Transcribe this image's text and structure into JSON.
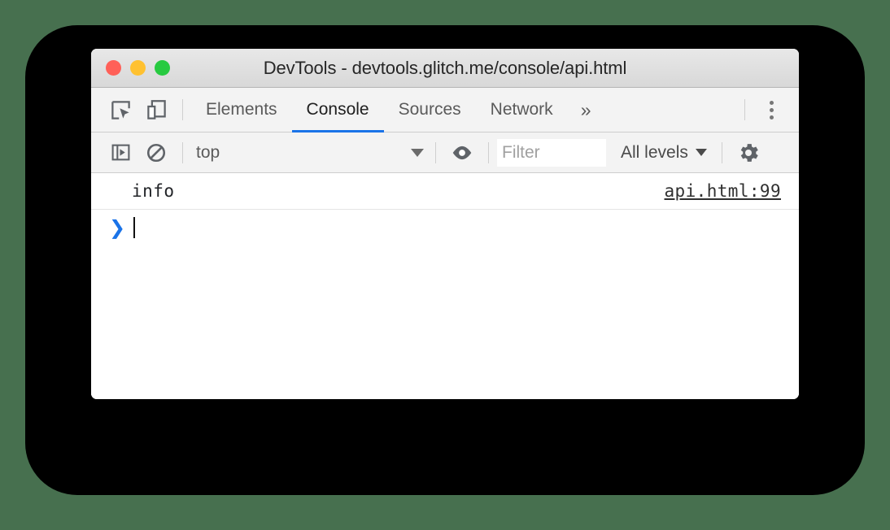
{
  "window": {
    "title": "DevTools - devtools.glitch.me/console/api.html",
    "traffic_lights": [
      {
        "name": "close",
        "color": "#ff6058"
      },
      {
        "name": "minimize",
        "color": "#ffc130"
      },
      {
        "name": "maximize",
        "color": "#27ca40"
      }
    ]
  },
  "colors": {
    "page_background": "#47704f",
    "backdrop": "#000000",
    "accent_blue": "#1a73e8",
    "toolbar_background": "#f3f3f3",
    "titlebar_background": "#e0e0e0"
  },
  "tabbar": {
    "left_icons": [
      {
        "name": "inspect-element-icon",
        "title": "Inspect"
      },
      {
        "name": "device-toolbar-icon",
        "title": "Toggle device toolbar"
      }
    ],
    "tabs": [
      {
        "label": "Elements",
        "active": false
      },
      {
        "label": "Console",
        "active": true
      },
      {
        "label": "Sources",
        "active": false
      },
      {
        "label": "Network",
        "active": false
      }
    ],
    "overflow_label": "»",
    "menu_icon": "more-vertical-icon"
  },
  "console_toolbar": {
    "sidebar_toggle_icon": "console-sidebar-icon",
    "clear_icon": "clear-console-icon",
    "context": {
      "value": "top",
      "caret": "chevron-down-icon"
    },
    "eye_icon": "live-expression-eye-icon",
    "filter": {
      "value": "",
      "placeholder": "Filter"
    },
    "levels": {
      "value": "All levels",
      "caret": "chevron-down-icon"
    },
    "settings_icon": "gear-icon"
  },
  "console": {
    "messages": [
      {
        "text": "info",
        "source": "api.html:99"
      }
    ],
    "prompt": {
      "chevron": "❯",
      "value": ""
    }
  }
}
